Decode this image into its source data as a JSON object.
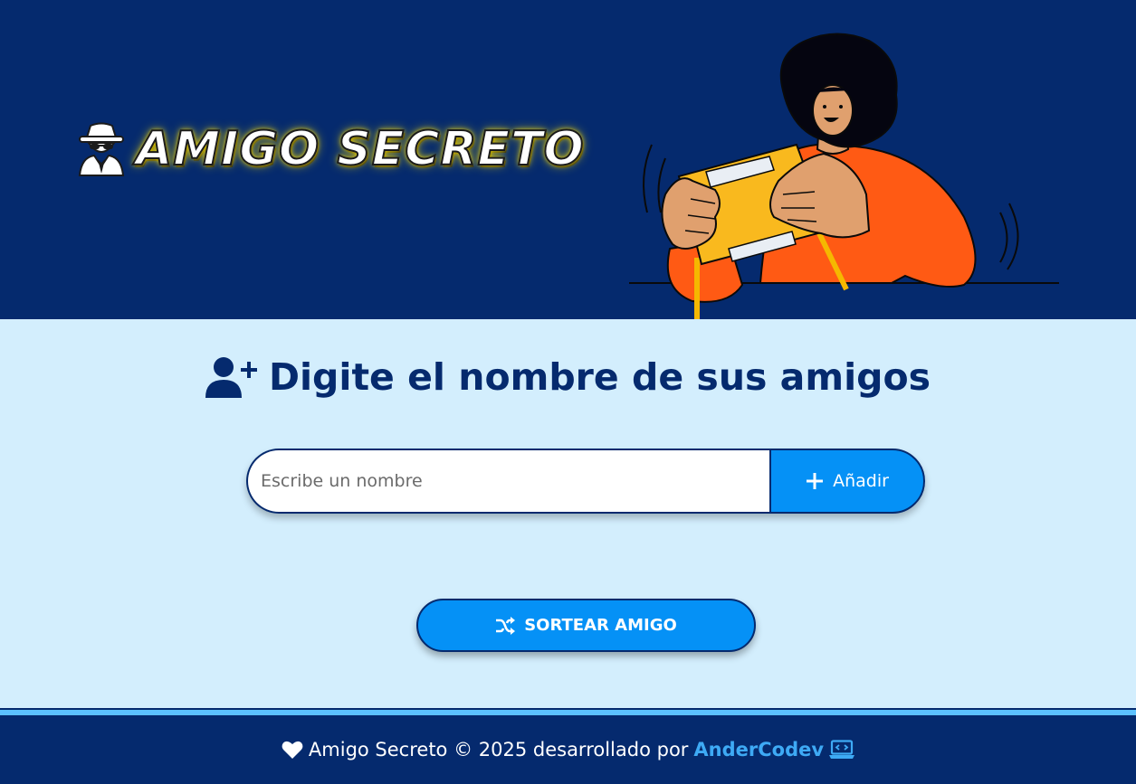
{
  "header": {
    "title": "AMIGO SECRETO",
    "title_icon": "spy-icon",
    "illustration": "person-holding-gift-box-illustration"
  },
  "main": {
    "heading": "Digite el nombre de sus amigos",
    "heading_icon": "add-user-icon",
    "input": {
      "placeholder": "Escribe un nombre",
      "value": ""
    },
    "add_button": {
      "label": "Añadir",
      "icon": "plus-icon"
    },
    "draw_button": {
      "label": "SORTEAR AMIGO",
      "icon": "shuffle-icon"
    }
  },
  "footer": {
    "text": "Amigo Secreto © 2025 desarrollado por",
    "author": "AnderCodev",
    "icons": [
      "heart-icon",
      "laptop-code-icon"
    ]
  },
  "colors": {
    "header_bg": "#052a6e",
    "body_bg": "#d3eefd",
    "accent": "#0591f6",
    "footer_link": "#3eaaf5",
    "title_glow": "#ffe300"
  }
}
